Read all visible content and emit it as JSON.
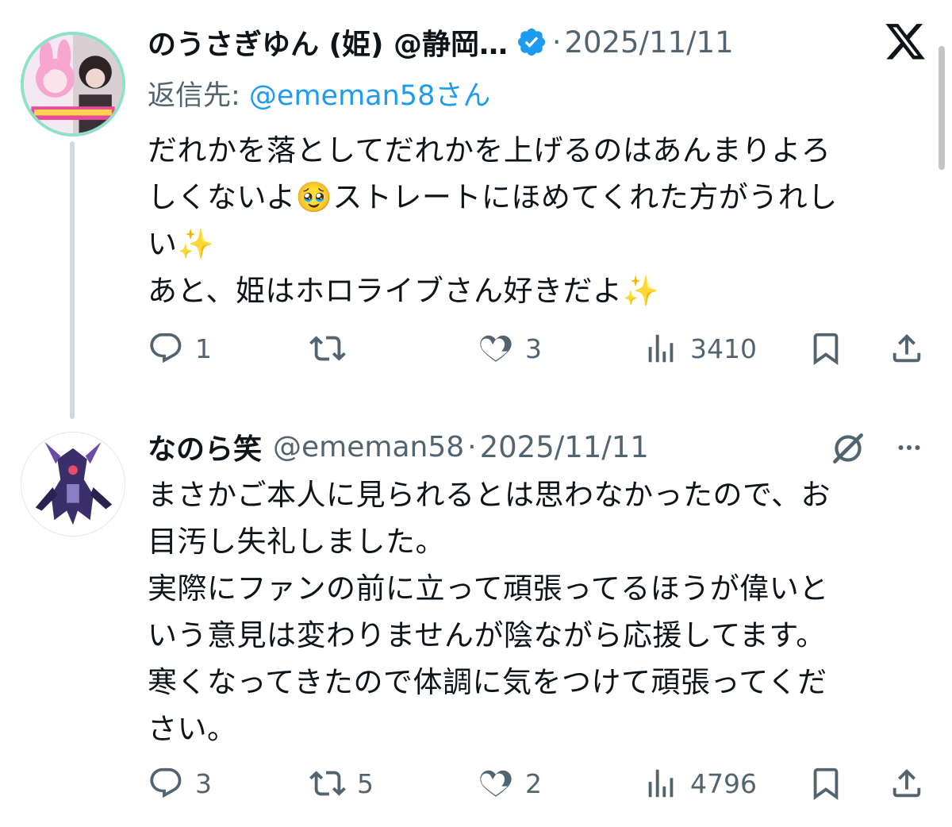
{
  "tweet1": {
    "display_name": "のうさぎゆん (姫) @静岡…",
    "date": "2025/11/11",
    "reply_to_prefix": "返信先: ",
    "reply_to_mention": "@ememan58",
    "reply_to_suffix": "さん",
    "body": "だれかを落としてだれかを上げるのはあんまりよろ\nしくないよ🥹ストレートにほめてくれた方がうれし\nい✨\nあと、姫はホロライブさん好きだよ✨",
    "replies": "1",
    "retweets": "",
    "likes": "3",
    "views": "3410",
    "verified_color": "#1d9bf0"
  },
  "tweet2": {
    "display_name": "なのら笑",
    "handle": "@ememan58",
    "date": "2025/11/11",
    "body": "まさかご本人に見られるとは思わなかったので、お\n目汚し失礼しました。\n実際にファンの前に立って頑張ってるほうが偉いと\nいう意見は変わりませんが陰ながら応援してます。\n寒くなってきたので体調に気をつけて頑張ってくだ\nさい。",
    "replies": "3",
    "retweets": "5",
    "likes": "2",
    "views": "4796"
  },
  "dot_separator": "·",
  "icons": {
    "close": "x-logo-icon",
    "grok": "grok-icon",
    "more": "more-icon",
    "reply": "reply-icon",
    "retweet": "retweet-icon",
    "like": "heart-icon",
    "views": "views-icon",
    "bookmark": "bookmark-icon",
    "share": "share-icon"
  },
  "colors": {
    "text": "#0f1419",
    "secondary": "#536471",
    "link": "#1d9bf0",
    "thread_line": "#cfd9de"
  }
}
